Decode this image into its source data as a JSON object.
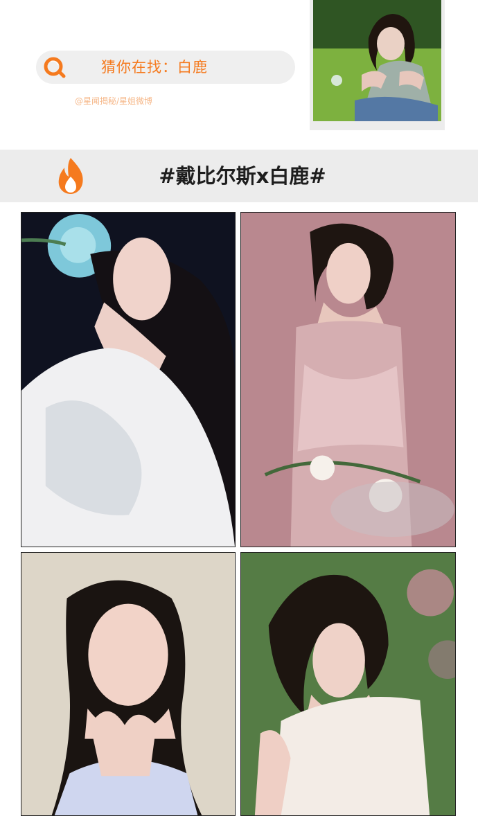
{
  "search": {
    "label": "猜你在找：白鹿",
    "icon": "search-icon",
    "accent_color": "#f57a1e"
  },
  "source": {
    "text": "@星闻揭秘/星姐微博"
  },
  "topic": {
    "icon": "fire-icon",
    "title": "#戴比尔斯x白鹿#",
    "icon_color": "#f57a1e"
  }
}
